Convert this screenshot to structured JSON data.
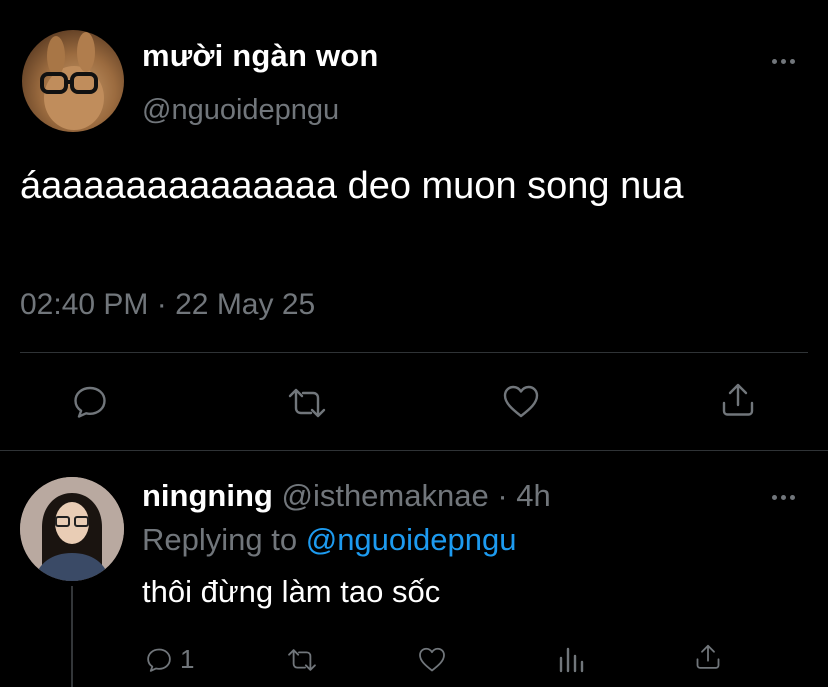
{
  "tweet": {
    "author_name": "mười ngàn won",
    "author_handle": "@nguoidepngu",
    "text": "áaaaaaaaaaaaaaa deo muon song nua",
    "time": "02:40 PM",
    "separator": "·",
    "date": "22 May 25"
  },
  "reply": {
    "author_name": "ningning",
    "author_handle": "@isthemaknae",
    "separator": "·",
    "age": "4h",
    "replying_to_label": "Replying to",
    "replying_to_handle": "@nguoidepngu",
    "text": "thôi đừng làm tao sốc",
    "reply_count": "1"
  },
  "icons": {
    "reply": "comment-icon",
    "retweet": "retweet-icon",
    "like": "heart-icon",
    "share": "share-icon",
    "analytics": "analytics-icon",
    "more": "more-icon"
  },
  "colors": {
    "background": "#000000",
    "text": "#ffffff",
    "muted": "#71767b",
    "link": "#1d9bf0",
    "divider": "#2f3336"
  }
}
